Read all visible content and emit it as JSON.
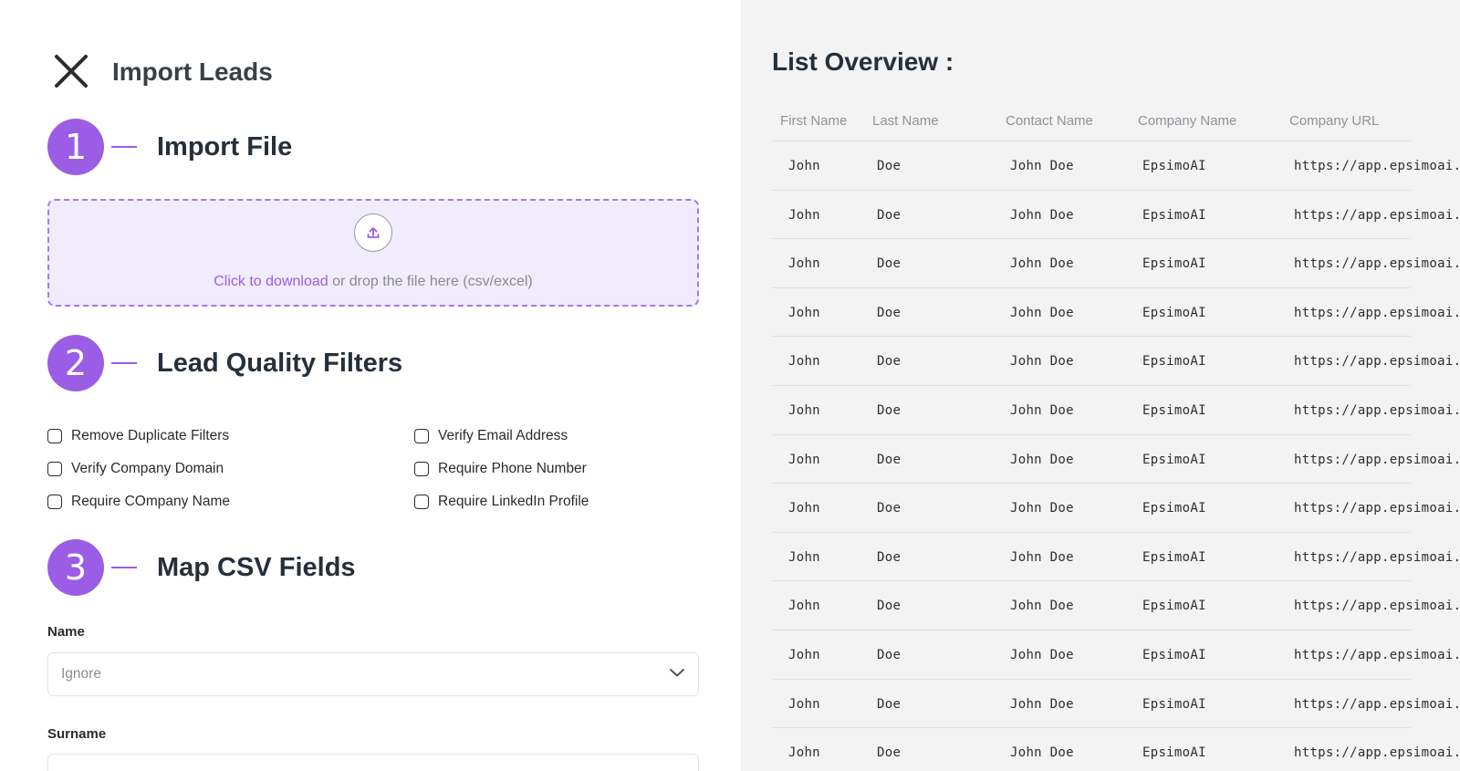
{
  "header": {
    "title": "Import Leads",
    "close_icon": "close-icon"
  },
  "steps": [
    {
      "number": "1",
      "title": "Import File"
    },
    {
      "number": "2",
      "title": "Lead Quality Filters"
    },
    {
      "number": "3",
      "title": "Map CSV Fields"
    }
  ],
  "dropzone": {
    "icon": "upload-icon",
    "link_text": "Click to download",
    "hint_text": " or drop the file here (csv/excel)"
  },
  "filters": [
    {
      "label": "Remove Duplicate Filters",
      "checked": false
    },
    {
      "label": "Verify Email Address",
      "checked": false
    },
    {
      "label": "Verify Company Domain",
      "checked": false
    },
    {
      "label": "Require Phone Number",
      "checked": false
    },
    {
      "label": "Require COmpany Name",
      "checked": false
    },
    {
      "label": "Require LinkedIn Profile",
      "checked": false
    }
  ],
  "mapping": {
    "name_label": "Name",
    "name_value": "Ignore",
    "surname_label": "Surname"
  },
  "overview": {
    "title": "List Overview :",
    "columns": [
      "First Name",
      "Last Name",
      "Contact Name",
      "Company Name",
      "Company URL"
    ],
    "rows": [
      [
        "John",
        "Doe",
        "John Doe",
        "EpsimoAI",
        "https://app.epsimoai.r"
      ],
      [
        "John",
        "Doe",
        "John Doe",
        "EpsimoAI",
        "https://app.epsimoai.r"
      ],
      [
        "John",
        "Doe",
        "John Doe",
        "EpsimoAI",
        "https://app.epsimoai.r"
      ],
      [
        "John",
        "Doe",
        "John Doe",
        "EpsimoAI",
        "https://app.epsimoai.r"
      ],
      [
        "John",
        "Doe",
        "John Doe",
        "EpsimoAI",
        "https://app.epsimoai.r"
      ],
      [
        "John",
        "Doe",
        "John Doe",
        "EpsimoAI",
        "https://app.epsimoai.r"
      ],
      [
        "John",
        "Doe",
        "John Doe",
        "EpsimoAI",
        "https://app.epsimoai.r"
      ],
      [
        "John",
        "Doe",
        "John Doe",
        "EpsimoAI",
        "https://app.epsimoai.r"
      ],
      [
        "John",
        "Doe",
        "John Doe",
        "EpsimoAI",
        "https://app.epsimoai.r"
      ],
      [
        "John",
        "Doe",
        "John Doe",
        "EpsimoAI",
        "https://app.epsimoai.r"
      ],
      [
        "John",
        "Doe",
        "John Doe",
        "EpsimoAI",
        "https://app.epsimoai.r"
      ],
      [
        "John",
        "Doe",
        "John Doe",
        "EpsimoAI",
        "https://app.epsimoai.r"
      ],
      [
        "John",
        "Doe",
        "John Doe",
        "EpsimoAI",
        "https://app.epsimoai.r"
      ]
    ]
  },
  "colors": {
    "accent": "#9b5de5",
    "dropzone_bg": "#f1ecfc",
    "panel_bg": "#f3f3f3"
  }
}
